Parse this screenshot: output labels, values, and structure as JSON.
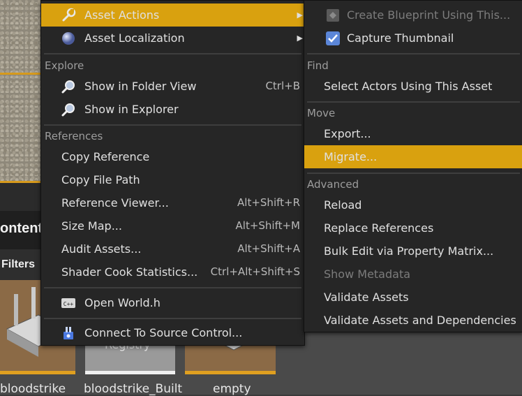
{
  "colors": {
    "highlight": "#d9a10f",
    "menu_bg": "#262626",
    "text": "#e0e0e0",
    "muted": "#9d9d9d",
    "disabled": "#7c7c7c"
  },
  "background": {
    "content_title": "ontent",
    "filters_label": "Filters",
    "tiles": [
      {
        "label": "bloodstrike"
      },
      {
        "label": "bloodstrike_Built",
        "thumb_text": "Registry"
      },
      {
        "label": "empty"
      }
    ]
  },
  "main_menu": {
    "items_top": [
      {
        "label": "Asset Actions",
        "icon": "wrench-icon",
        "has_submenu": true,
        "highlighted": true
      },
      {
        "label": "Asset Localization",
        "icon": "globe-icon",
        "has_submenu": true
      }
    ],
    "explore": {
      "header": "Explore",
      "items": [
        {
          "label": "Show in Folder View",
          "icon": "magnifier-icon",
          "shortcut": "Ctrl+B"
        },
        {
          "label": "Show in Explorer",
          "icon": "magnifier-icon",
          "shortcut": ""
        }
      ]
    },
    "references": {
      "header": "References",
      "items": [
        {
          "label": "Copy Reference",
          "shortcut": ""
        },
        {
          "label": "Copy File Path",
          "shortcut": ""
        },
        {
          "label": "Reference Viewer...",
          "shortcut": "Alt+Shift+R"
        },
        {
          "label": "Size Map...",
          "shortcut": "Alt+Shift+M"
        },
        {
          "label": "Audit Assets...",
          "shortcut": "Alt+Shift+A"
        },
        {
          "label": "Shader Cook Statistics...",
          "shortcut": "Ctrl+Alt+Shift+S"
        }
      ]
    },
    "open_world": {
      "label": "Open World.h",
      "icon": "cpp-file-icon"
    },
    "source_control": {
      "label": "Connect To Source Control...",
      "icon": "source-control-icon"
    }
  },
  "sub_menu": {
    "items_top": [
      {
        "label": "Create Blueprint Using This...",
        "icon": "blueprint-icon",
        "disabled": true
      },
      {
        "label": "Capture Thumbnail",
        "icon": "checkbox-icon"
      }
    ],
    "find": {
      "header": "Find",
      "items": [
        {
          "label": "Select Actors Using This Asset"
        }
      ]
    },
    "move": {
      "header": "Move",
      "items": [
        {
          "label": "Export..."
        },
        {
          "label": "Migrate...",
          "highlighted": true
        }
      ]
    },
    "advanced": {
      "header": "Advanced",
      "items": [
        {
          "label": "Reload"
        },
        {
          "label": "Replace References"
        },
        {
          "label": "Bulk Edit via Property Matrix..."
        },
        {
          "label": "Show Metadata",
          "disabled": true
        },
        {
          "label": "Validate Assets"
        },
        {
          "label": "Validate Assets and Dependencies"
        }
      ]
    }
  }
}
